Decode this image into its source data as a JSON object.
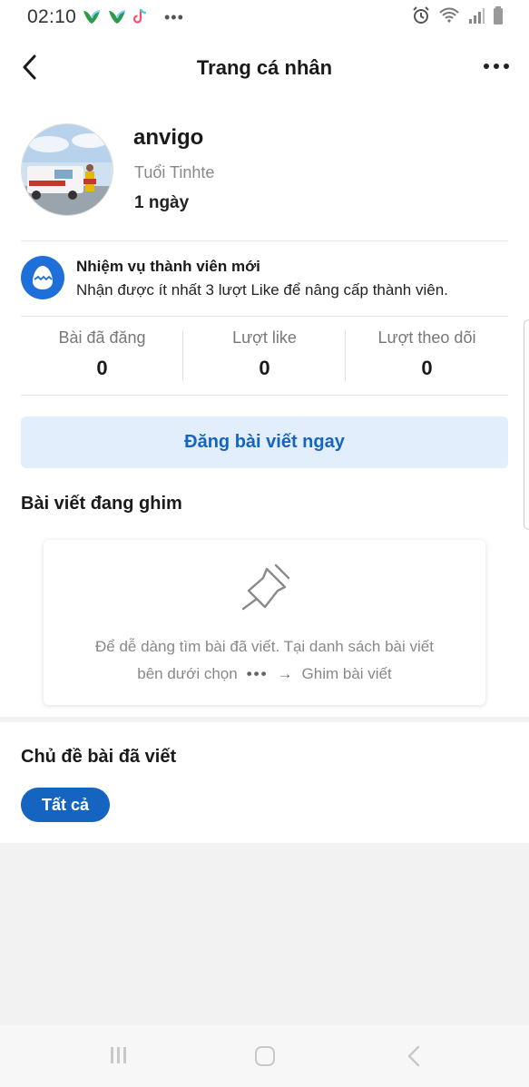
{
  "status_bar": {
    "time": "02:10",
    "more_indicator": "•••"
  },
  "header": {
    "title": "Trang cá nhân"
  },
  "profile": {
    "username": "anvigo",
    "member_title": "Tuổi Tinhte",
    "member_age": "1 ngày"
  },
  "mission": {
    "title": "Nhiệm vụ thành viên mới",
    "description": "Nhận được ít nhất 3 lượt Like để nâng cấp thành viên."
  },
  "stats": [
    {
      "label": "Bài đã đăng",
      "value": "0"
    },
    {
      "label": "Lượt like",
      "value": "0"
    },
    {
      "label": "Lượt theo dõi",
      "value": "0"
    }
  ],
  "post_now_button": "Đăng bài viết ngay",
  "pinned": {
    "title": "Bài viết đang ghim",
    "hint_line1": "Để dễ dàng tìm bài đã viết. Tại danh sách bài viết",
    "hint_line2_prefix": "bên dưới chọn",
    "hint_line2_dots": "•••",
    "hint_line2_arrow": "→",
    "hint_line2_suffix": "Ghim bài viết"
  },
  "topics": {
    "title": "Chủ đề bài đã viết",
    "chips": [
      {
        "label": "Tất cả",
        "selected": true
      }
    ]
  },
  "colors": {
    "accent": "#1565c0",
    "accent_light": "#e2eefb",
    "mission_icon_bg": "#1e6fd9"
  }
}
